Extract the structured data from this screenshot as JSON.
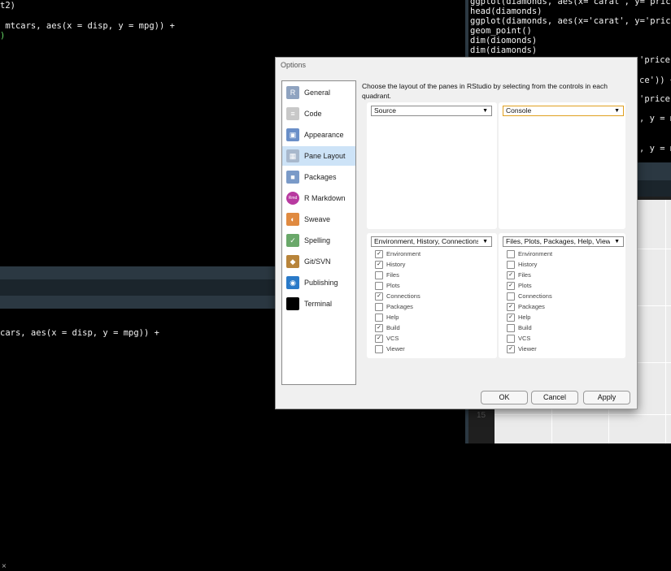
{
  "editor_top": {
    "line1": "t2)",
    "line2": " mtcars, aes(x = disp, y = mpg)) +",
    "line3": ")"
  },
  "console_bottom": {
    "line1": "cars, aes(x = disp, y = mpg)) +",
    "close_glyph": "×"
  },
  "right_console": {
    "lines": [
      "ggplot(diamonds, aes(x='carat', y= price",
      "head(diamonds)",
      "ggplot(diamonds, aes(x='carat', y='price'",
      "geom_point()",
      "dim(diomonds)",
      "dim(diamonds)"
    ],
    "partial_lines": [
      "'price'",
      "ce')) +",
      "'price'",
      ", y = m",
      ", y = m"
    ]
  },
  "plot": {
    "y_tick": "15"
  },
  "dialog": {
    "title": "Options",
    "description": "Choose the layout of the panes in RStudio by selecting from the controls in each quadrant.",
    "sidebar": [
      {
        "label": "General",
        "icon": "r-logo-icon",
        "color": "#8fa3c0",
        "glyph": "R"
      },
      {
        "label": "Code",
        "icon": "code-icon",
        "color": "#c8c8c8",
        "glyph": "≡"
      },
      {
        "label": "Appearance",
        "icon": "appearance-icon",
        "color": "#6a8fc8",
        "glyph": "▣"
      },
      {
        "label": "Pane Layout",
        "icon": "pane-layout-icon",
        "color": "#a8b8cc",
        "glyph": "▦",
        "active": true
      },
      {
        "label": "Packages",
        "icon": "packages-icon",
        "color": "#7a9ac8",
        "glyph": "■"
      },
      {
        "label": "R Markdown",
        "icon": "rmarkdown-icon",
        "color": "#b83aa0",
        "glyph": "Rmd"
      },
      {
        "label": "Sweave",
        "icon": "sweave-icon",
        "color": "#e08a40",
        "glyph": "◐"
      },
      {
        "label": "Spelling",
        "icon": "spelling-icon",
        "color": "#6aa86a",
        "glyph": "✓"
      },
      {
        "label": "Git/SVN",
        "icon": "git-icon",
        "color": "#b8843a",
        "glyph": "◆"
      },
      {
        "label": "Publishing",
        "icon": "publishing-icon",
        "color": "#2a7ac8",
        "glyph": "◉"
      },
      {
        "label": "Terminal",
        "icon": "terminal-icon",
        "color": "#000000",
        "glyph": ""
      }
    ],
    "quadrants": {
      "top_left": "Source",
      "top_right": "Console",
      "bottom_left": "Environment, History, Connections",
      "bottom_right": "Files, Plots, Packages, Help, Viewer"
    },
    "bottom_left_options": [
      {
        "label": "Environment",
        "checked": true
      },
      {
        "label": "History",
        "checked": true
      },
      {
        "label": "Files",
        "checked": false
      },
      {
        "label": "Plots",
        "checked": false
      },
      {
        "label": "Connections",
        "checked": true
      },
      {
        "label": "Packages",
        "checked": false
      },
      {
        "label": "Help",
        "checked": false
      },
      {
        "label": "Build",
        "checked": true
      },
      {
        "label": "VCS",
        "checked": true
      },
      {
        "label": "Viewer",
        "checked": false
      }
    ],
    "bottom_right_options": [
      {
        "label": "Environment",
        "checked": false
      },
      {
        "label": "History",
        "checked": false
      },
      {
        "label": "Files",
        "checked": true
      },
      {
        "label": "Plots",
        "checked": true
      },
      {
        "label": "Connections",
        "checked": false
      },
      {
        "label": "Packages",
        "checked": true
      },
      {
        "label": "Help",
        "checked": true
      },
      {
        "label": "Build",
        "checked": false
      },
      {
        "label": "VCS",
        "checked": false
      },
      {
        "label": "Viewer",
        "checked": true
      }
    ],
    "buttons": {
      "ok": "OK",
      "cancel": "Cancel",
      "apply": "Apply"
    }
  }
}
